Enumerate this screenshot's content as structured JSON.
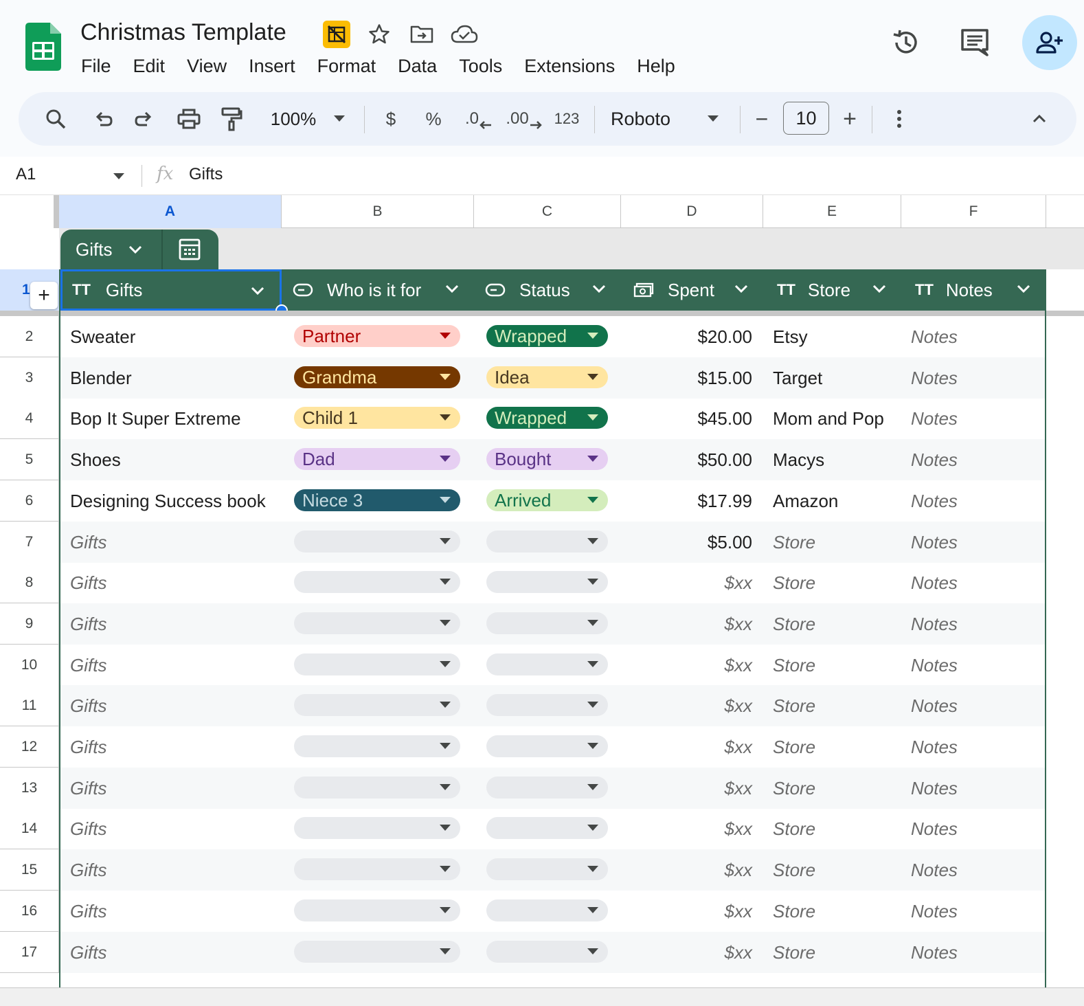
{
  "app": {
    "doc_title": "Christmas Template",
    "menu": [
      "File",
      "Edit",
      "View",
      "Insert",
      "Format",
      "Data",
      "Tools",
      "Extensions",
      "Help"
    ]
  },
  "toolbar": {
    "zoom": "100%",
    "currency": "$",
    "percent": "%",
    "decrease_decimal": ".0",
    "increase_decimal": ".00",
    "number_format": "123",
    "font": "Roboto",
    "font_size": "10",
    "minus": "−",
    "plus": "+"
  },
  "formula_bar": {
    "name_box": "A1",
    "fx": "fx",
    "value": "Gifts"
  },
  "columns": [
    "A",
    "B",
    "C",
    "D",
    "E",
    "F"
  ],
  "table": {
    "name": "Gifts",
    "add_row_symbol": "+",
    "headers": [
      {
        "label": "Gifts",
        "type_icon": "text-type-icon",
        "glyph": "TT"
      },
      {
        "label": "Who is it for",
        "type_icon": "dropdown-type-icon"
      },
      {
        "label": "Status",
        "type_icon": "dropdown-type-icon"
      },
      {
        "label": "Spent",
        "type_icon": "currency-type-icon"
      },
      {
        "label": "Store",
        "type_icon": "text-type-icon",
        "glyph": "TT"
      },
      {
        "label": "Notes",
        "type_icon": "text-type-icon",
        "glyph": "TT"
      }
    ],
    "rows": [
      {
        "num": "2",
        "gift": "Sweater",
        "who": "Partner",
        "status": "Wrapped",
        "spent": "$20.00",
        "store": "Etsy",
        "notes": "Notes"
      },
      {
        "num": "3",
        "gift": "Blender",
        "who": "Grandma",
        "status": "Idea",
        "spent": "$15.00",
        "store": "Target",
        "notes": "Notes"
      },
      {
        "num": "4",
        "gift": "Bop It Super Extreme",
        "who": "Child 1",
        "status": "Wrapped",
        "spent": "$45.00",
        "store": "Mom and Pop",
        "notes": "Notes"
      },
      {
        "num": "5",
        "gift": "Shoes",
        "who": "Dad",
        "status": "Bought",
        "spent": "$50.00",
        "store": "Macys",
        "notes": "Notes"
      },
      {
        "num": "6",
        "gift": "Designing Success book",
        "who": "Niece 3",
        "status": "Arrived",
        "spent": "$17.99",
        "store": "Amazon",
        "notes": "Notes"
      },
      {
        "num": "7",
        "gift": "Gifts",
        "who": "",
        "status": "",
        "spent": "$5.00",
        "store": "Store",
        "notes": "Notes"
      },
      {
        "num": "8",
        "gift": "Gifts",
        "who": "",
        "status": "",
        "spent": "$xx",
        "store": "Store",
        "notes": "Notes"
      },
      {
        "num": "9",
        "gift": "Gifts",
        "who": "",
        "status": "",
        "spent": "$xx",
        "store": "Store",
        "notes": "Notes"
      },
      {
        "num": "10",
        "gift": "Gifts",
        "who": "",
        "status": "",
        "spent": "$xx",
        "store": "Store",
        "notes": "Notes"
      },
      {
        "num": "11",
        "gift": "Gifts",
        "who": "",
        "status": "",
        "spent": "$xx",
        "store": "Store",
        "notes": "Notes"
      },
      {
        "num": "12",
        "gift": "Gifts",
        "who": "",
        "status": "",
        "spent": "$xx",
        "store": "Store",
        "notes": "Notes"
      },
      {
        "num": "13",
        "gift": "Gifts",
        "who": "",
        "status": "",
        "spent": "$xx",
        "store": "Store",
        "notes": "Notes"
      },
      {
        "num": "14",
        "gift": "Gifts",
        "who": "",
        "status": "",
        "spent": "$xx",
        "store": "Store",
        "notes": "Notes"
      },
      {
        "num": "15",
        "gift": "Gifts",
        "who": "",
        "status": "",
        "spent": "$xx",
        "store": "Store",
        "notes": "Notes"
      },
      {
        "num": "16",
        "gift": "Gifts",
        "who": "",
        "status": "",
        "spent": "$xx",
        "store": "Store",
        "notes": "Notes"
      },
      {
        "num": "17",
        "gift": "Gifts",
        "who": "",
        "status": "",
        "spent": "$xx",
        "store": "Store",
        "notes": "Notes"
      }
    ]
  },
  "first_row_num": "1",
  "chip_colors": {
    "Partner": {
      "bg": "#ffcfc9",
      "fg": "#b10202"
    },
    "Grandma": {
      "bg": "#753800",
      "fg": "#ffe5a0"
    },
    "Child 1": {
      "bg": "#ffe5a0",
      "fg": "#473821"
    },
    "Dad": {
      "bg": "#e6cff2",
      "fg": "#5a3286"
    },
    "Niece 3": {
      "bg": "#215a6c",
      "fg": "#c6dbe1"
    },
    "Wrapped": {
      "bg": "#11734b",
      "fg": "#d4edbc"
    },
    "Idea": {
      "bg": "#ffe5a0",
      "fg": "#473821"
    },
    "Bought": {
      "bg": "#e6cff2",
      "fg": "#5a3286"
    },
    "Arrived": {
      "bg": "#d4edbc",
      "fg": "#11734b"
    },
    "empty": {
      "bg": "#e8eaed",
      "fg": "#444746"
    }
  },
  "colors": {
    "table_green": "#356853",
    "selection_blue": "#1a73e8",
    "share_bg": "#c2e7ff",
    "sheets_green": "#0f9d58"
  }
}
